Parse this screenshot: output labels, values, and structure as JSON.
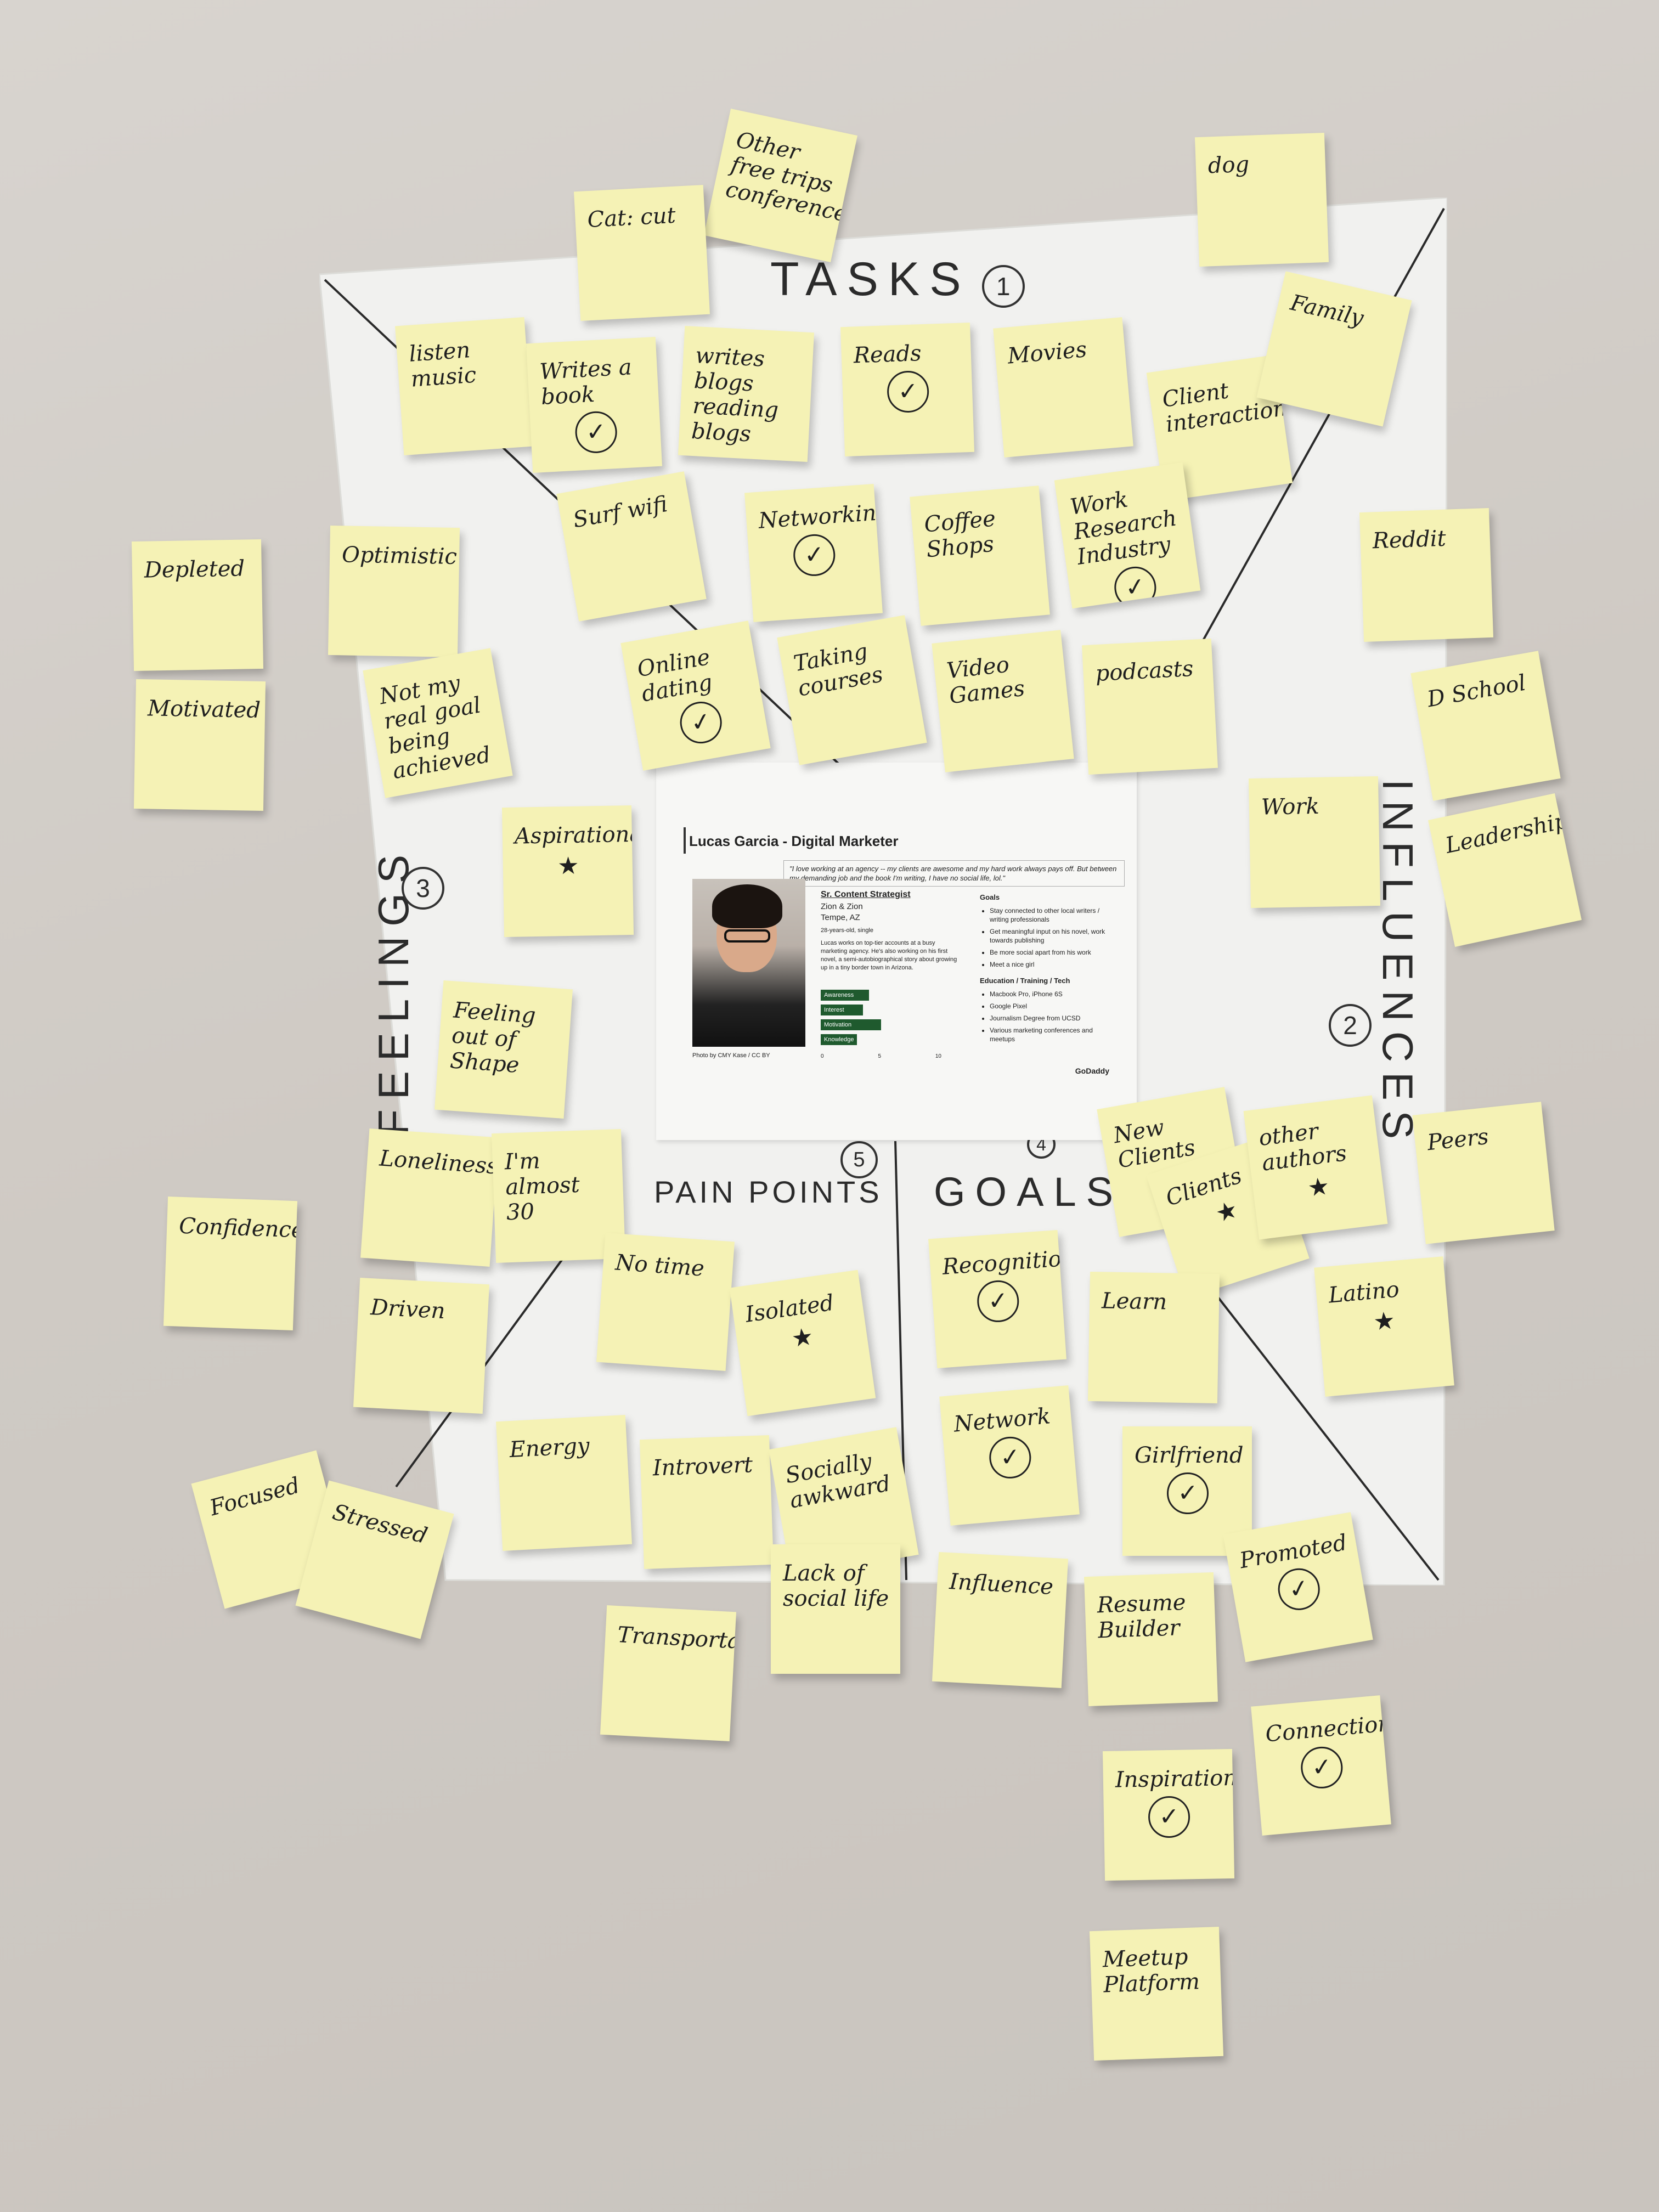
{
  "board": {
    "quadrants": {
      "tasks": {
        "label": "TASKS",
        "number": "1"
      },
      "influences": {
        "label": "INFLUENCES",
        "number": "2"
      },
      "feelings": {
        "label": "FEELINGS",
        "number": "3"
      },
      "goals": {
        "label": "GOALS",
        "number": "4"
      },
      "pain_points": {
        "label": "PAIN POINTS",
        "number": "5"
      }
    }
  },
  "persona": {
    "title": "Lucas Garcia - Digital Marketer",
    "quote": "\"I love working at an agency -- my clients are awesome and my hard work always pays off. But between my demanding job and the book I'm writing, I have no social life, lol.\"",
    "role": "Sr. Content Strategist",
    "company": "Zion & Zion",
    "location": "Tempe, AZ",
    "age": "28-years-old, single",
    "bio": "Lucas works on top-tier accounts at a busy marketing agency. He's also working on his first novel, a semi-autobiographical story about growing up in a tiny border town in Arizona.",
    "bars": [
      {
        "label": "Awareness",
        "value": 4
      },
      {
        "label": "Interest",
        "value": 3.5
      },
      {
        "label": "Motivation",
        "value": 5
      },
      {
        "label": "Knowledge",
        "value": 3
      }
    ],
    "axis": [
      "0",
      "5",
      "10"
    ],
    "photo_credit": "Photo by CMY Kase / CC BY",
    "goals_heading": "Goals",
    "goals": [
      "Stay connected to other local writers / writing professionals",
      "Get meaningful input on his novel, work towards publishing",
      "Be more social apart from his work",
      "Meet a nice girl"
    ],
    "edu_heading": "Education / Training / Tech",
    "edu": [
      "Macbook Pro, iPhone 6S",
      "Google Pixel",
      "Journalism Degree from UCSD",
      "Various marketing conferences and meetups"
    ],
    "brand": "GoDaddy"
  },
  "notes": [
    {
      "text": "Other free trips conferences",
      "mark": ""
    },
    {
      "text": "Cat: cut",
      "mark": ""
    },
    {
      "text": "dog",
      "mark": ""
    },
    {
      "text": "listen music",
      "mark": ""
    },
    {
      "text": "Writes a book",
      "mark": "check"
    },
    {
      "text": "writes blogs reading blogs",
      "mark": ""
    },
    {
      "text": "Reads",
      "mark": "check"
    },
    {
      "text": "Movies",
      "mark": ""
    },
    {
      "text": "Client interactions",
      "mark": ""
    },
    {
      "text": "Family",
      "mark": ""
    },
    {
      "text": "Surf wifi",
      "mark": ""
    },
    {
      "text": "Networking",
      "mark": "check"
    },
    {
      "text": "Coffee Shops",
      "mark": ""
    },
    {
      "text": "Work Research Industry",
      "mark": "check"
    },
    {
      "text": "Reddit",
      "mark": ""
    },
    {
      "text": "Depleted",
      "mark": ""
    },
    {
      "text": "Optimistic",
      "mark": ""
    },
    {
      "text": "Motivated",
      "mark": ""
    },
    {
      "text": "Not my real goal being achieved",
      "mark": ""
    },
    {
      "text": "Online dating",
      "mark": "check"
    },
    {
      "text": "Taking courses",
      "mark": ""
    },
    {
      "text": "Video Games",
      "mark": ""
    },
    {
      "text": "podcasts",
      "mark": ""
    },
    {
      "text": "D School",
      "mark": ""
    },
    {
      "text": "Aspirational",
      "mark": "star"
    },
    {
      "text": "Work",
      "mark": ""
    },
    {
      "text": "Leadership",
      "mark": ""
    },
    {
      "text": "Feeling out of Shape",
      "mark": ""
    },
    {
      "text": "Loneliness",
      "mark": ""
    },
    {
      "text": "I'm almost 30",
      "mark": ""
    },
    {
      "text": "New Clients",
      "mark": ""
    },
    {
      "text": "Clients",
      "mark": "star"
    },
    {
      "text": "other authors",
      "mark": "star"
    },
    {
      "text": "Peers",
      "mark": ""
    },
    {
      "text": "Confidence",
      "mark": ""
    },
    {
      "text": "No time",
      "mark": ""
    },
    {
      "text": "Isolated",
      "mark": "star"
    },
    {
      "text": "Recognition",
      "mark": "check"
    },
    {
      "text": "Learn",
      "mark": ""
    },
    {
      "text": "Latino",
      "mark": "star"
    },
    {
      "text": "Driven",
      "mark": ""
    },
    {
      "text": "Energy",
      "mark": ""
    },
    {
      "text": "Introvert",
      "mark": ""
    },
    {
      "text": "Socially awkward",
      "mark": ""
    },
    {
      "text": "Network",
      "mark": "check"
    },
    {
      "text": "Girlfriend",
      "mark": "check"
    },
    {
      "text": "Focused",
      "mark": ""
    },
    {
      "text": "Stressed",
      "mark": ""
    },
    {
      "text": "Lack of social life",
      "mark": ""
    },
    {
      "text": "Influence",
      "mark": ""
    },
    {
      "text": "Resume Builder",
      "mark": ""
    },
    {
      "text": "Promoted",
      "mark": "check"
    },
    {
      "text": "Transportation",
      "mark": ""
    },
    {
      "text": "Inspiration",
      "mark": "check"
    },
    {
      "text": "Connection",
      "mark": "check"
    },
    {
      "text": "Meetup Platform",
      "mark": ""
    }
  ]
}
